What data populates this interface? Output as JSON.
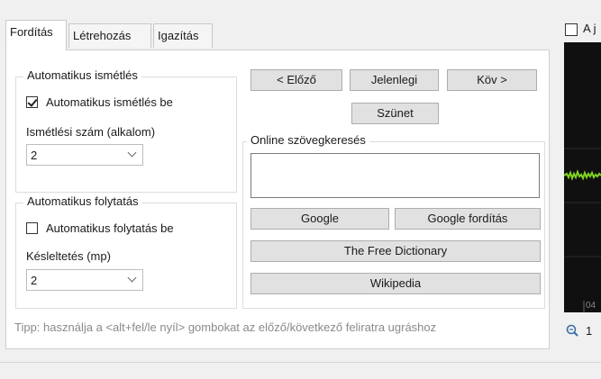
{
  "tabs": [
    "Fordítás",
    "Létrehozás",
    "Igazítás"
  ],
  "auto_repeat": {
    "title": "Automatikus ismétlés",
    "checkbox_label": "Automatikus ismétlés be",
    "checked": true,
    "count_label": "Ismétlési szám (alkalom)",
    "count_value": "2"
  },
  "auto_continue": {
    "title": "Automatikus folytatás",
    "checkbox_label": "Automatikus folytatás be",
    "checked": false,
    "delay_label": "Késleltetés (mp)",
    "delay_value": "2"
  },
  "nav": {
    "prev": "< Előző",
    "current": "Jelenlegi",
    "next": "Köv >",
    "pause": "Szünet"
  },
  "online_search": {
    "title": "Online szövegkeresés",
    "value": "",
    "buttons": {
      "google": "Google",
      "google_translate": "Google fordítás",
      "free_dictionary": "The Free Dictionary",
      "wikipedia": "Wikipedia"
    }
  },
  "tip": "Tipp: használja a <alt+fel/le nyíl> gombokat az előző/következő feliratra ugráshoz",
  "right_panel": {
    "checkbox_label": "A j",
    "time_label": "04",
    "zoom_value": "1"
  },
  "colors": {
    "waveform_bg": "#101010",
    "waveform": "#7ed321"
  }
}
